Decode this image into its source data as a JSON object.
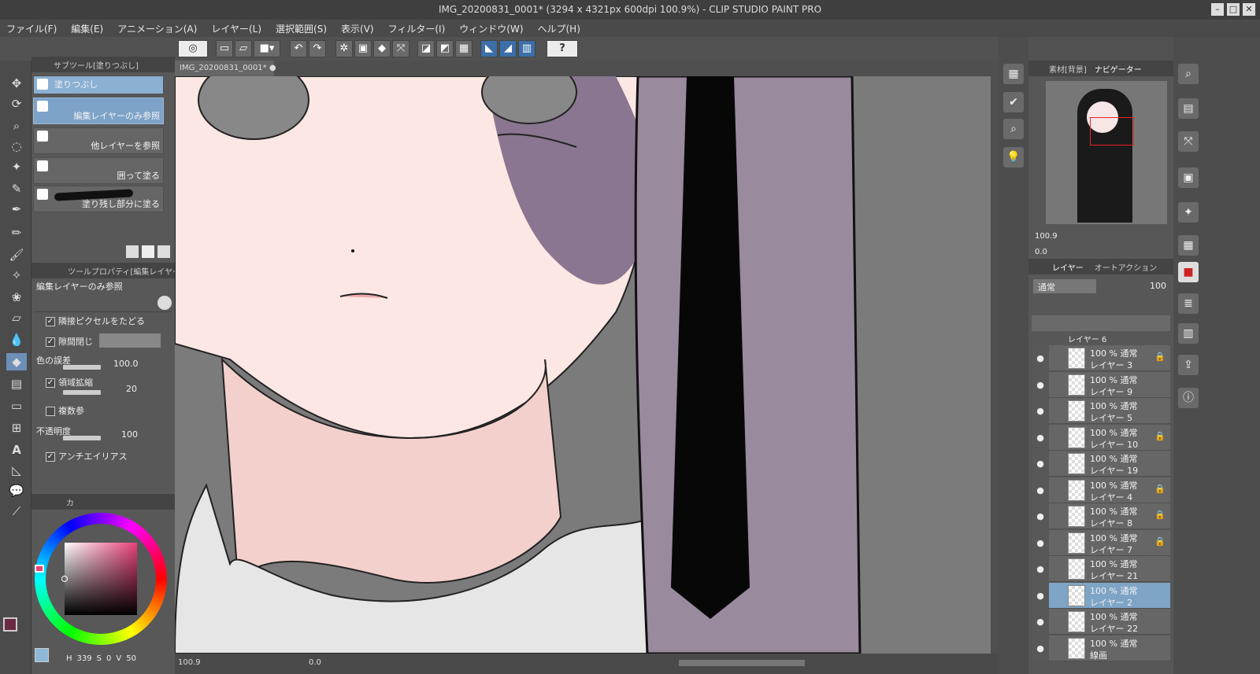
{
  "window": {
    "title": "IMG_20200831_0001* (3294 x 4321px 600dpi 100.9%)  - CLIP STUDIO PAINT PRO",
    "controls": [
      "–",
      "□",
      "✕"
    ]
  },
  "menu": [
    "ファイル(F)",
    "編集(E)",
    "アニメーション(A)",
    "レイヤー(L)",
    "選択範囲(S)",
    "表示(V)",
    "フィルター(I)",
    "ウィンドウ(W)",
    "ヘルプ(H)"
  ],
  "subtool": {
    "panel_title": "サブツール[塗りつぶし]",
    "group_label": "塗りつぶし",
    "items": [
      "編集レイヤーのみ参照",
      "他レイヤーを参照",
      "囲って塗る",
      "塗り残し部分に塗る"
    ]
  },
  "toolprop": {
    "panel_title": "ツールプロパティ[編集レイヤーのみ",
    "preset_name": "編集レイヤーのみ参照",
    "adjacent_label": "隣接ピクセルをたどる",
    "gap_label": "隙間閉じ",
    "color_margin_label": "色の誤差",
    "color_margin_value": "100.0",
    "area_scale_label": "領域拡縮",
    "area_scale_value": "20",
    "multiple_label": "複数参",
    "opacity_label": "不透明度",
    "opacity_value": "100",
    "antialias_label": "アンチエイリアス"
  },
  "color": {
    "tab_label": "カ",
    "hsv": {
      "h_label": "H",
      "h": "339",
      "s_label": "S",
      "s": "0",
      "v_label": "V",
      "v": "50"
    },
    "main_color": "#6a2a44",
    "sub_color": "#ffffff"
  },
  "document": {
    "tab_label": "IMG_20200831_0001*",
    "zoom": "100.9",
    "angle": "0.0"
  },
  "navigator": {
    "tab_materials": "素材[背景]",
    "tab_navigator": "ナビゲーター",
    "zoom": "100.9",
    "angle": "0.0"
  },
  "layers": {
    "tab_layer": "レイヤー",
    "tab_autoaction": "オートアクション",
    "blend_mode": "通常",
    "opacity": "100",
    "partial_top": "レイヤー 6",
    "list": [
      {
        "mode": "100 % 通常",
        "name": "レイヤー 3",
        "locked": true,
        "selected": false
      },
      {
        "mode": "100 % 通常",
        "name": "レイヤー 9",
        "locked": false,
        "selected": false
      },
      {
        "mode": "100 % 通常",
        "name": "レイヤー 5",
        "locked": false,
        "selected": false
      },
      {
        "mode": "100 % 通常",
        "name": "レイヤー 10",
        "locked": true,
        "selected": false
      },
      {
        "mode": "100 % 通常",
        "name": "レイヤー 19",
        "locked": false,
        "selected": false
      },
      {
        "mode": "100 % 通常",
        "name": "レイヤー 4",
        "locked": true,
        "selected": false
      },
      {
        "mode": "100 % 通常",
        "name": "レイヤー 8",
        "locked": true,
        "selected": false
      },
      {
        "mode": "100 % 通常",
        "name": "レイヤー 7",
        "locked": true,
        "selected": false
      },
      {
        "mode": "100 % 通常",
        "name": "レイヤー 21",
        "locked": false,
        "selected": false
      },
      {
        "mode": "100 % 通常",
        "name": "レイヤー 2",
        "locked": false,
        "selected": true
      },
      {
        "mode": "100 % 通常",
        "name": "レイヤー 22",
        "locked": false,
        "selected": false
      },
      {
        "mode": "100 % 通常",
        "name": "線画",
        "locked": false,
        "selected": false
      }
    ],
    "lock_glyph": "🔒",
    "eye_glyph": "●"
  },
  "icons": {
    "help": "?",
    "text_tool": "A"
  },
  "accent_color": "#7ea4c6"
}
